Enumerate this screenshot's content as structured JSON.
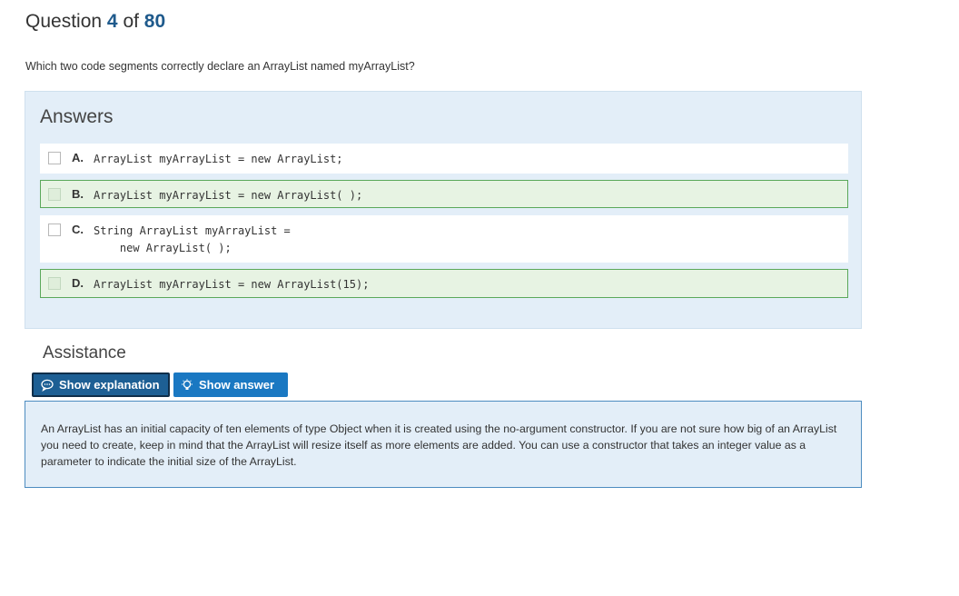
{
  "header": {
    "prefix": "Question",
    "current": "4",
    "separator": "of",
    "total": "80"
  },
  "question": {
    "text": "Which two code segments correctly declare an ArrayList named myArrayList?"
  },
  "answers": {
    "title": "Answers",
    "options": [
      {
        "letter": "A.",
        "code": "ArrayList myArrayList = new ArrayList;",
        "correct": false
      },
      {
        "letter": "B.",
        "code": "ArrayList myArrayList = new ArrayList( );",
        "correct": true
      },
      {
        "letter": "C.",
        "code": "String ArrayList myArrayList =\n    new ArrayList( );",
        "correct": false
      },
      {
        "letter": "D.",
        "code": "ArrayList myArrayList = new ArrayList(15);",
        "correct": true
      }
    ]
  },
  "assistance": {
    "title": "Assistance",
    "show_explanation_label": "Show explanation",
    "show_answer_label": "Show answer",
    "explanation_icon": "speech-bubble-icon",
    "answer_icon": "lightbulb-icon"
  },
  "explanation": {
    "text": "An ArrayList has an initial capacity of ten elements of type Object when it is created using the no-argument constructor. If you are not sure how big of an ArrayList you need to create, keep in mind that the ArrayList will resize itself as more elements are added. You can use a constructor that takes an integer value as a parameter to indicate the initial size of the ArrayList."
  },
  "colors": {
    "accent": "#1a78c2",
    "correct_border": "#5aa85a",
    "panel_bg": "#e3eef8"
  }
}
